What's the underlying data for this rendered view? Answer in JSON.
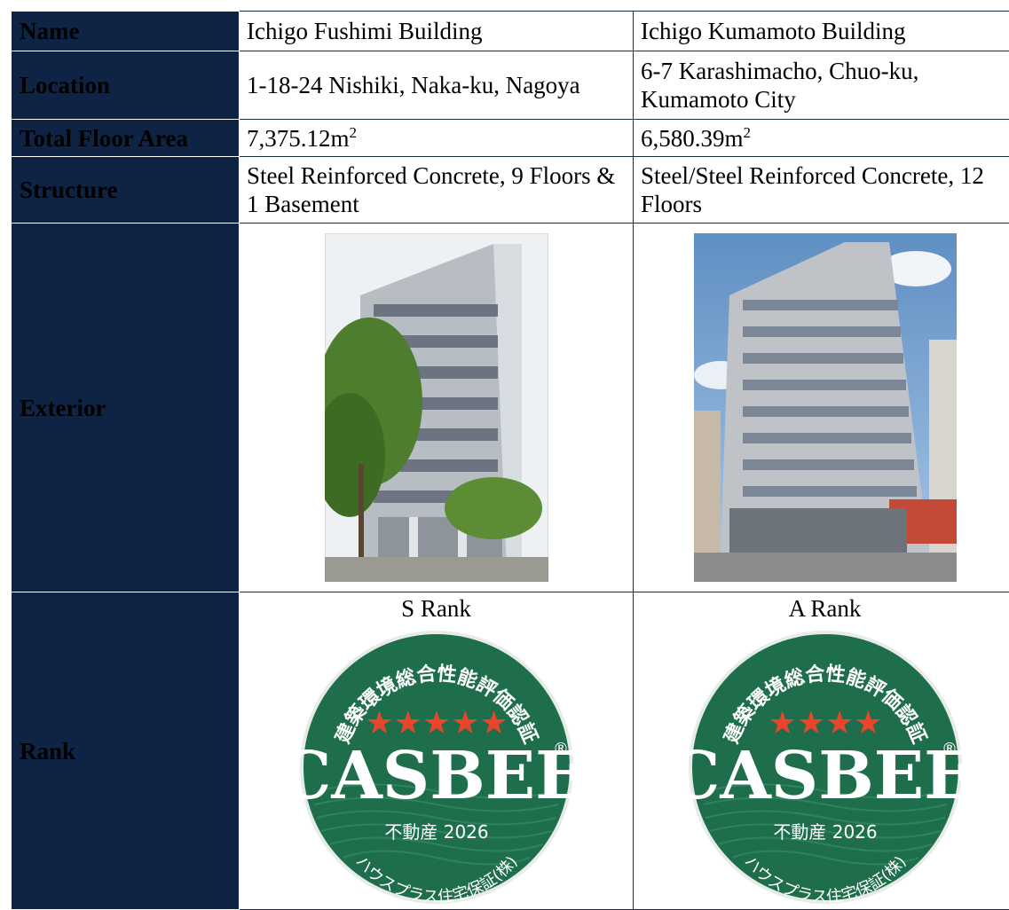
{
  "rows": {
    "name": {
      "label": "Name",
      "col1": "Ichigo Fushimi Building",
      "col2": "Ichigo Kumamoto Building"
    },
    "location": {
      "label": "Location",
      "col1": "1-18-24 Nishiki, Naka-ku, Nagoya",
      "col2": "6-7 Karashimacho, Chuo-ku, Kumamoto City"
    },
    "floor_area": {
      "label": "Total Floor Area",
      "col1": "7,375.12m",
      "col2": "6,580.39m",
      "unit_sup": "2"
    },
    "structure": {
      "label": "Structure",
      "col1": "Steel Reinforced Concrete, 9 Floors & 1 Basement",
      "col2": "Steel/Steel Reinforced Concrete, 12 Floors"
    },
    "exterior": {
      "label": "Exterior"
    },
    "rank": {
      "label": "Rank",
      "col1": "S Rank",
      "col2": "A Rank",
      "badge": {
        "top_text": "建築環境総合性能評価認証",
        "brand": "CASBEE",
        "reg_mark": "®",
        "product": "不動産 2026",
        "bottom_text": "ハウスプラス住宅保証(株)",
        "col1_stars": "★★★★★",
        "col2_stars": "★★★★"
      }
    }
  },
  "colors": {
    "header_bg": "#0f2444",
    "badge_green": "#1f6e4b",
    "star_red": "#e8452d"
  }
}
